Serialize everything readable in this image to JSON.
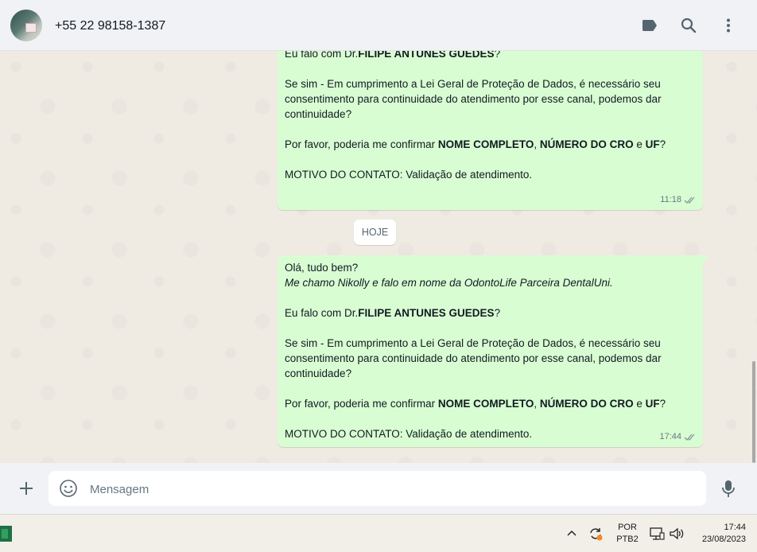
{
  "header": {
    "contact": "+55 22 98158-1387",
    "icons": [
      "label-icon",
      "search-icon",
      "more-vertical-icon"
    ]
  },
  "messages": [
    {
      "lines": [
        {
          "parts": [
            {
              "t": "Eu falo com Dr."
            },
            {
              "t": "FILIPE ANTUNES GUEDES",
              "b": true
            },
            {
              "t": "?"
            }
          ]
        },
        {
          "blank": true
        },
        {
          "parts": [
            {
              "t": "Se sim - Em cumprimento a Lei Geral de Proteção de Dados, é necessário seu"
            }
          ]
        },
        {
          "parts": [
            {
              "t": "consentimento para continuidade do atendimento por esse canal, podemos dar"
            }
          ]
        },
        {
          "parts": [
            {
              "t": "continuidade?"
            }
          ]
        },
        {
          "blank": true
        },
        {
          "parts": [
            {
              "t": "Por favor, poderia me confirmar "
            },
            {
              "t": "NOME COMPLETO",
              "b": true
            },
            {
              "t": ", "
            },
            {
              "t": "NÚMERO DO CRO",
              "b": true
            },
            {
              "t": " e "
            },
            {
              "t": "UF",
              "b": true
            },
            {
              "t": "?"
            }
          ]
        },
        {
          "blank": true
        },
        {
          "parts": [
            {
              "t": "MOTIVO DO CONTATO: Validação de atendimento."
            }
          ]
        }
      ],
      "time": "11:18",
      "status": "delivered"
    },
    {
      "lines": [
        {
          "parts": [
            {
              "t": "Olá, tudo bem?"
            }
          ]
        },
        {
          "parts": [
            {
              "t": "Me chamo Nikolly e falo em nome da OdontoLife Parceira DentalUni.",
              "i": true
            }
          ]
        },
        {
          "blank": true
        },
        {
          "parts": [
            {
              "t": "Eu falo com Dr."
            },
            {
              "t": "FILIPE ANTUNES GUEDES",
              "b": true
            },
            {
              "t": "?"
            }
          ]
        },
        {
          "blank": true
        },
        {
          "parts": [
            {
              "t": "Se sim - Em cumprimento a Lei Geral de Proteção de Dados, é necessário seu"
            }
          ]
        },
        {
          "parts": [
            {
              "t": "consentimento para continuidade do atendimento por esse canal, podemos dar"
            }
          ]
        },
        {
          "parts": [
            {
              "t": "continuidade?"
            }
          ]
        },
        {
          "blank": true
        },
        {
          "parts": [
            {
              "t": "Por favor, poderia me confirmar "
            },
            {
              "t": "NOME COMPLETO",
              "b": true
            },
            {
              "t": ", "
            },
            {
              "t": "NÚMERO DO CRO",
              "b": true
            },
            {
              "t": " e "
            },
            {
              "t": "UF",
              "b": true
            },
            {
              "t": "?"
            }
          ]
        },
        {
          "blank": true
        },
        {
          "parts": [
            {
              "t": "MOTIVO DO CONTATO: Validação de atendimento."
            }
          ]
        }
      ],
      "time": "17:44",
      "status": "delivered"
    }
  ],
  "day_divider": "HOJE",
  "composer": {
    "placeholder": "Mensagem"
  },
  "taskbar": {
    "lang_top": "POR",
    "lang_bottom": "PTB2",
    "time": "17:44",
    "date": "23/08/2023"
  },
  "colors": {
    "bubble_out": "#d9fdd3",
    "chat_bg": "#efeae2",
    "header_bg": "#f0f2f5",
    "tick": "#8696a0"
  }
}
